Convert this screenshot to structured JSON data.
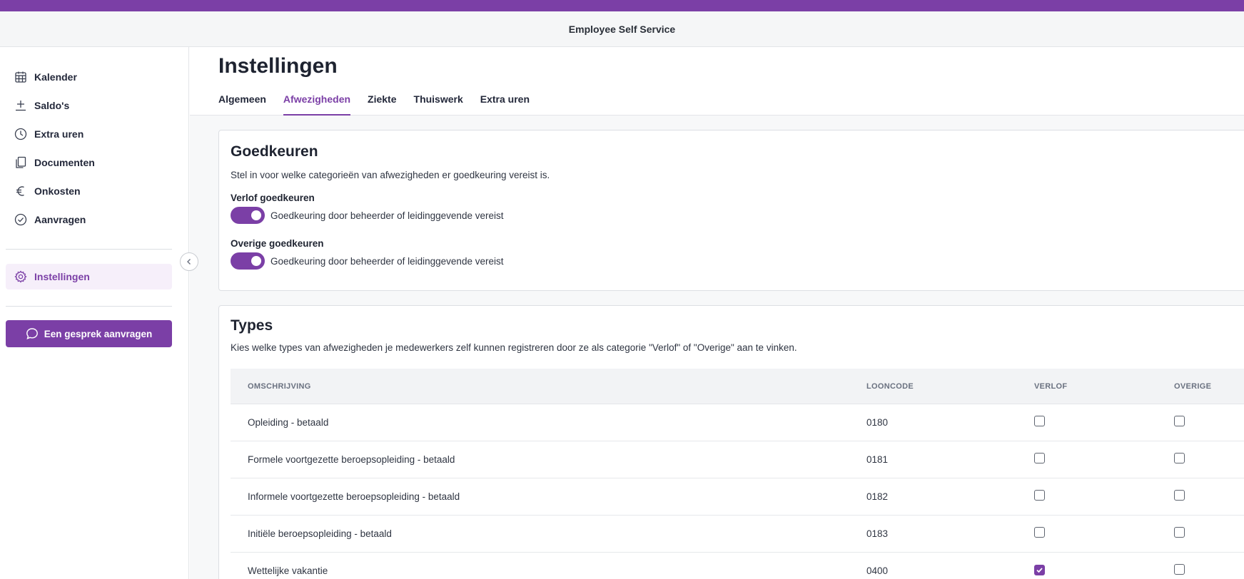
{
  "header": {
    "title": "Employee Self Service"
  },
  "colors": {
    "accent": "#7b3fa6",
    "accent_light": "#f6effa"
  },
  "sidebar": {
    "items": [
      {
        "label": "Kalender",
        "icon": "calendar-icon"
      },
      {
        "label": "Saldo's",
        "icon": "balance-icon"
      },
      {
        "label": "Extra uren",
        "icon": "clock-icon"
      },
      {
        "label": "Documenten",
        "icon": "documents-icon"
      },
      {
        "label": "Onkosten",
        "icon": "euro-icon"
      },
      {
        "label": "Aanvragen",
        "icon": "check-circle-icon"
      }
    ],
    "settings": {
      "label": "Instellingen",
      "icon": "gear-icon"
    },
    "cta": {
      "label": "Een gesprek aanvragen",
      "icon": "chat-icon"
    }
  },
  "page": {
    "title": "Instellingen",
    "tabs": [
      {
        "label": "Algemeen",
        "active": false
      },
      {
        "label": "Afwezigheden",
        "active": true
      },
      {
        "label": "Ziekte",
        "active": false
      },
      {
        "label": "Thuiswerk",
        "active": false
      },
      {
        "label": "Extra uren",
        "active": false
      }
    ]
  },
  "approvals": {
    "title": "Goedkeuren",
    "description": "Stel in voor welke categorieën van afwezigheden er goedkeuring vereist is.",
    "leave": {
      "label": "Verlof goedkeuren",
      "toggle_text": "Goedkeuring door beheerder of leidinggevende vereist",
      "enabled": true
    },
    "other": {
      "label": "Overige goedkeuren",
      "toggle_text": "Goedkeuring door beheerder of leidinggevende vereist",
      "enabled": true
    }
  },
  "types": {
    "title": "Types",
    "description": "Kies welke types van afwezigheden je medewerkers zelf kunnen registreren door ze als categorie \"Verlof\" of \"Overige\" aan te vinken.",
    "columns": {
      "description": "OMSCHRIJVING",
      "code": "LOONCODE",
      "leave": "VERLOF",
      "other": "OVERIGE"
    },
    "rows": [
      {
        "description": "Opleiding - betaald",
        "code": "0180",
        "leave": false,
        "other": false
      },
      {
        "description": "Formele voortgezette beroepsopleiding - betaald",
        "code": "0181",
        "leave": false,
        "other": false
      },
      {
        "description": "Informele voortgezette beroepsopleiding - betaald",
        "code": "0182",
        "leave": false,
        "other": false
      },
      {
        "description": "Initiële beroepsopleiding - betaald",
        "code": "0183",
        "leave": false,
        "other": false
      },
      {
        "description": "Wettelijke vakantie",
        "code": "0400",
        "leave": true,
        "other": false
      }
    ]
  }
}
